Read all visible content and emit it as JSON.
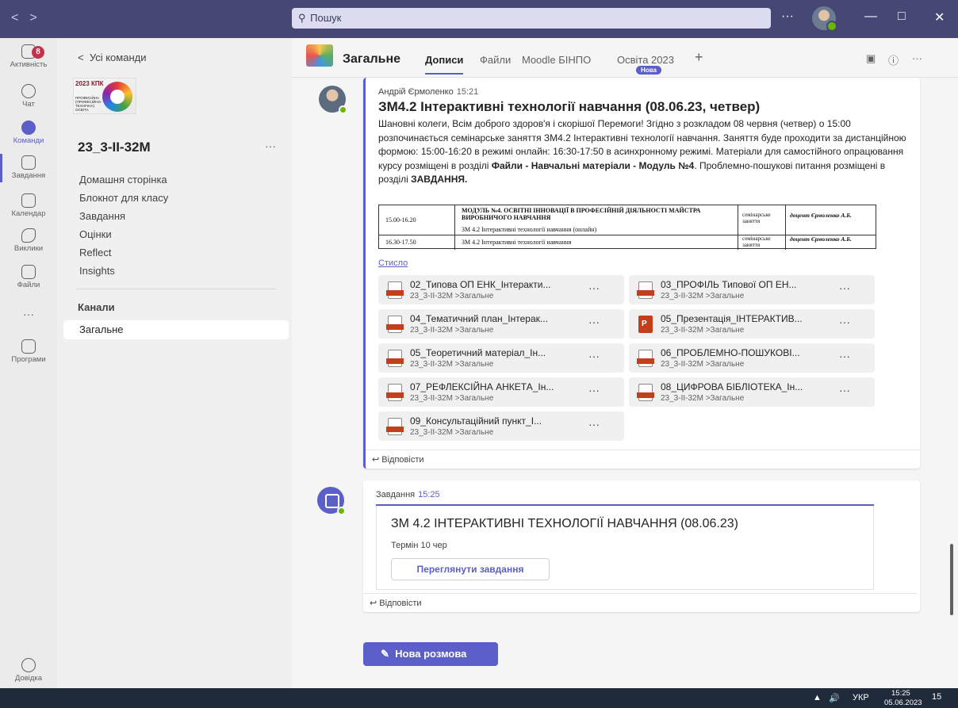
{
  "search": {
    "placeholder": "Пошук"
  },
  "titlebar": {
    "more": "···",
    "minimize": "—",
    "maximize": "□",
    "close": "✕",
    "back": "<",
    "forward": ">"
  },
  "rail": {
    "activity": {
      "label": "Активність",
      "badge": "8"
    },
    "chat": {
      "label": "Чат"
    },
    "teams": {
      "label": "Команди"
    },
    "assignments": {
      "label": "Завдання"
    },
    "calendar": {
      "label": "Календар"
    },
    "calls": {
      "label": "Виклики"
    },
    "files": {
      "label": "Файли"
    },
    "more": "···",
    "apps": {
      "label": "Програми"
    },
    "help": {
      "label": "Довідка"
    }
  },
  "teampane": {
    "back": "Усі команди",
    "logo_text": "2023 КПК",
    "logo_sub": "ПРОФЕСІЙНА (ПРОФЕСІЙНО-ТЕХНІЧНА) ОСВІТА",
    "team_name": "23_3-ІІ-32М",
    "team_more": "···",
    "nav": [
      "Домашня сторінка",
      "Блокнот для класу",
      "Завдання",
      "Оцінки",
      "Reflect",
      "Insights"
    ],
    "channels_heading": "Канали",
    "channels": [
      "Загальне"
    ]
  },
  "header": {
    "channel": "Загальне",
    "tabs": [
      "Дописи",
      "Файли",
      "Moodle БІНПО",
      "Освіта 2023"
    ],
    "new_badge": "Нова",
    "add": "+",
    "info": "ⓘ",
    "more": "···"
  },
  "post": {
    "author": "Андрій Єрмоленко",
    "time": "15:21",
    "subject": "ЗМ4.2 Інтерактивні технології навчання (08.06.23, четвер)",
    "body_1": "Шановні колеги, Всім доброго здоров'я і скорішої Перемоги! Згідно з розкладом 08 червня (четвер) о 15:00 розпочинається семінарське заняття ЗМ4.2 Інтерактивні технології навчання. Заняття буде проходити за дистанційною формою: 15:00-16:20 в режимі онлайн: 16:30-17:50 в асинхронному режимі. Матеріали для самостійного опрацювання курсу розміщені в розділі ",
    "body_bold_1": "Файли - Навчальні матеріали - Модуль №4",
    "body_2": ". Проблемно-пошукові питання розміщені в розділі ",
    "body_bold_2": "ЗАВДАННЯ.",
    "schedule": {
      "row1_time": "15.00-16.20",
      "module": "МОДУЛЬ №4. ОСВІТНІ ІННОВАЦІЇ В ПРОФЕСІЙНІЙ ДІЯЛЬНОСТІ МАЙСТРА ВИРОБНИЧОГО НАВЧАННЯ",
      "row1_topic": "ЗМ 4.2 Інтерактивні технології навчання (онлайн)",
      "row1_type": "семінарське заняття",
      "row1_teacher": "доцент Єрмоленко А.Б.",
      "row2_time": "16.30-17.50",
      "row2_topic": "ЗМ 4.2 Інтерактивні технології навчання",
      "row2_type": "семінарське заняття",
      "row2_teacher": "доцент Єрмоленко А.Б."
    },
    "see_less": "Стисло",
    "attachments": [
      {
        "name": "02_Типова ОП ЕНК_Інтеракти...",
        "path": "23_3-ІІ-32М >Загальне"
      },
      {
        "name": "03_ПРОФІЛЬ Типової ОП ЕН...",
        "path": "23_3-ІІ-32М >Загальне"
      },
      {
        "name": "04_Тематичний план_Інтерак...",
        "path": "23_3-ІІ-32М >Загальне"
      },
      {
        "name": "05_Презентація_ІНТЕРАКТИВ...",
        "path": "23_3-ІІ-32М >Загальне"
      },
      {
        "name": "05_Теоретичний матеріал_Ін...",
        "path": "23_3-ІІ-32М >Загальне"
      },
      {
        "name": "06_ПРОБЛЕМНО-ПОШУКОВІ...",
        "path": "23_3-ІІ-32М >Загальне"
      },
      {
        "name": "07_РЕФЛЕКСІЙНА АНКЕТА_Ін...",
        "path": "23_3-ІІ-32М >Загальне"
      },
      {
        "name": "08_ЦИФРОВА БІБЛІОТЕКА_Ін...",
        "path": "23_3-ІІ-32М >Загальне"
      },
      {
        "name": "09_Консультаційний пункт_І...",
        "path": "23_3-ІІ-32М >Загальне"
      }
    ],
    "attachment_more": "···",
    "reply": "Відповісти"
  },
  "task_post": {
    "author": "Завдання",
    "time": "15:25",
    "title": "ЗМ 4.2 ІНТЕРАКТИВНІ ТЕХНОЛОГІЇ НАВЧАННЯ (08.06.23)",
    "due": "Термін 10 чер",
    "button": "Переглянути завдання",
    "reply": "Відповісти"
  },
  "new_conversation": "Нова розмова",
  "taskbar": {
    "lang": "УКР",
    "time": "15:25",
    "date": "05.06.2023",
    "notif": "15"
  }
}
